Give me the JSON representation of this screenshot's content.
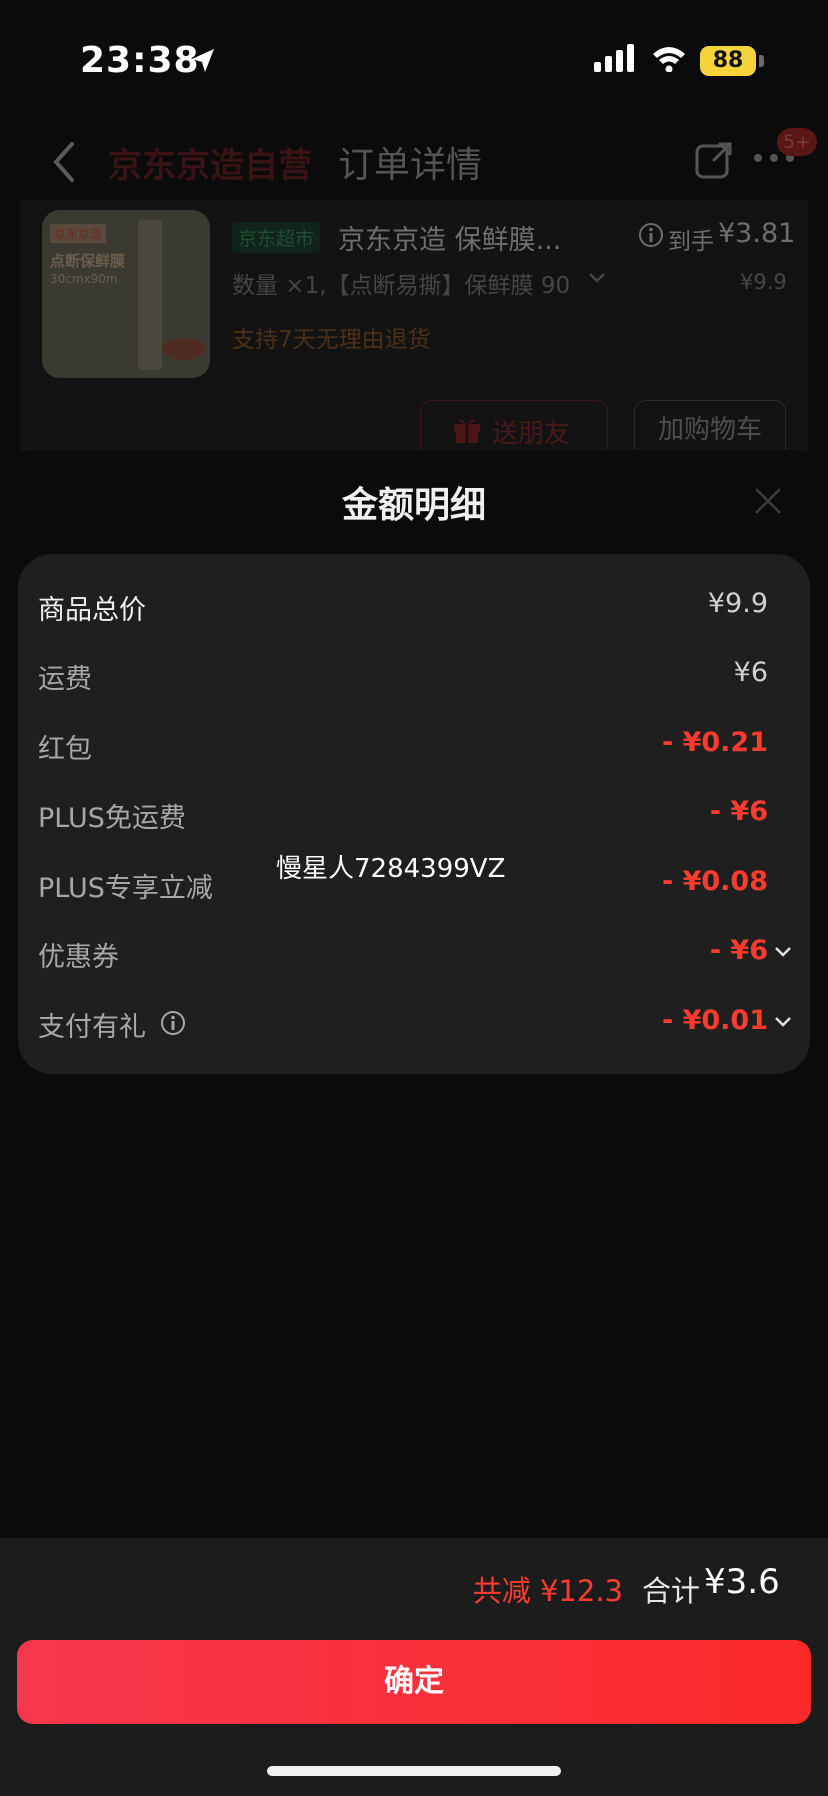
{
  "status_bar": {
    "time": "23:38",
    "battery": "88"
  },
  "background_page": {
    "store_name": "京东京造自营",
    "nav_title": "订单详情",
    "badge": "5+",
    "product": {
      "tag": "京东超市",
      "title": "京东京造 保鲜膜...",
      "arrive_label": "到手",
      "arrive_price": "¥3.81",
      "spec": "数量 ×1,【点断易撕】保鲜膜 90",
      "original_price": "¥9.9",
      "return_policy": "支持7天无理由退货",
      "thumb_tag": "京东京造",
      "thumb_name": "点断保鲜膜",
      "thumb_size": "30cmx90m"
    },
    "buttons": {
      "gift": "送朋友",
      "cart": "加购物车"
    }
  },
  "sheet": {
    "title": "金额明细",
    "rows": [
      {
        "label": "商品总价",
        "value": "¥9.9"
      },
      {
        "label": "运费",
        "value": "¥6"
      },
      {
        "label": "红包",
        "value": "- ¥0.21"
      },
      {
        "label": "PLUS免运费",
        "value": "- ¥6"
      },
      {
        "label": "PLUS专享立减",
        "value": "- ¥0.08"
      },
      {
        "label": "优惠券",
        "value": "- ¥6"
      },
      {
        "label": "支付有礼",
        "value": "- ¥0.01"
      }
    ],
    "watermark": "慢星人7284399VZ"
  },
  "footer": {
    "savings": "共减 ¥12.3",
    "total_label": "合计",
    "total_value": "¥3.6",
    "confirm": "确定"
  },
  "colors": {
    "accent_red": "#ff3b30",
    "battery_yellow": "#f5d33b",
    "card_bg": "#1f1f1f"
  }
}
